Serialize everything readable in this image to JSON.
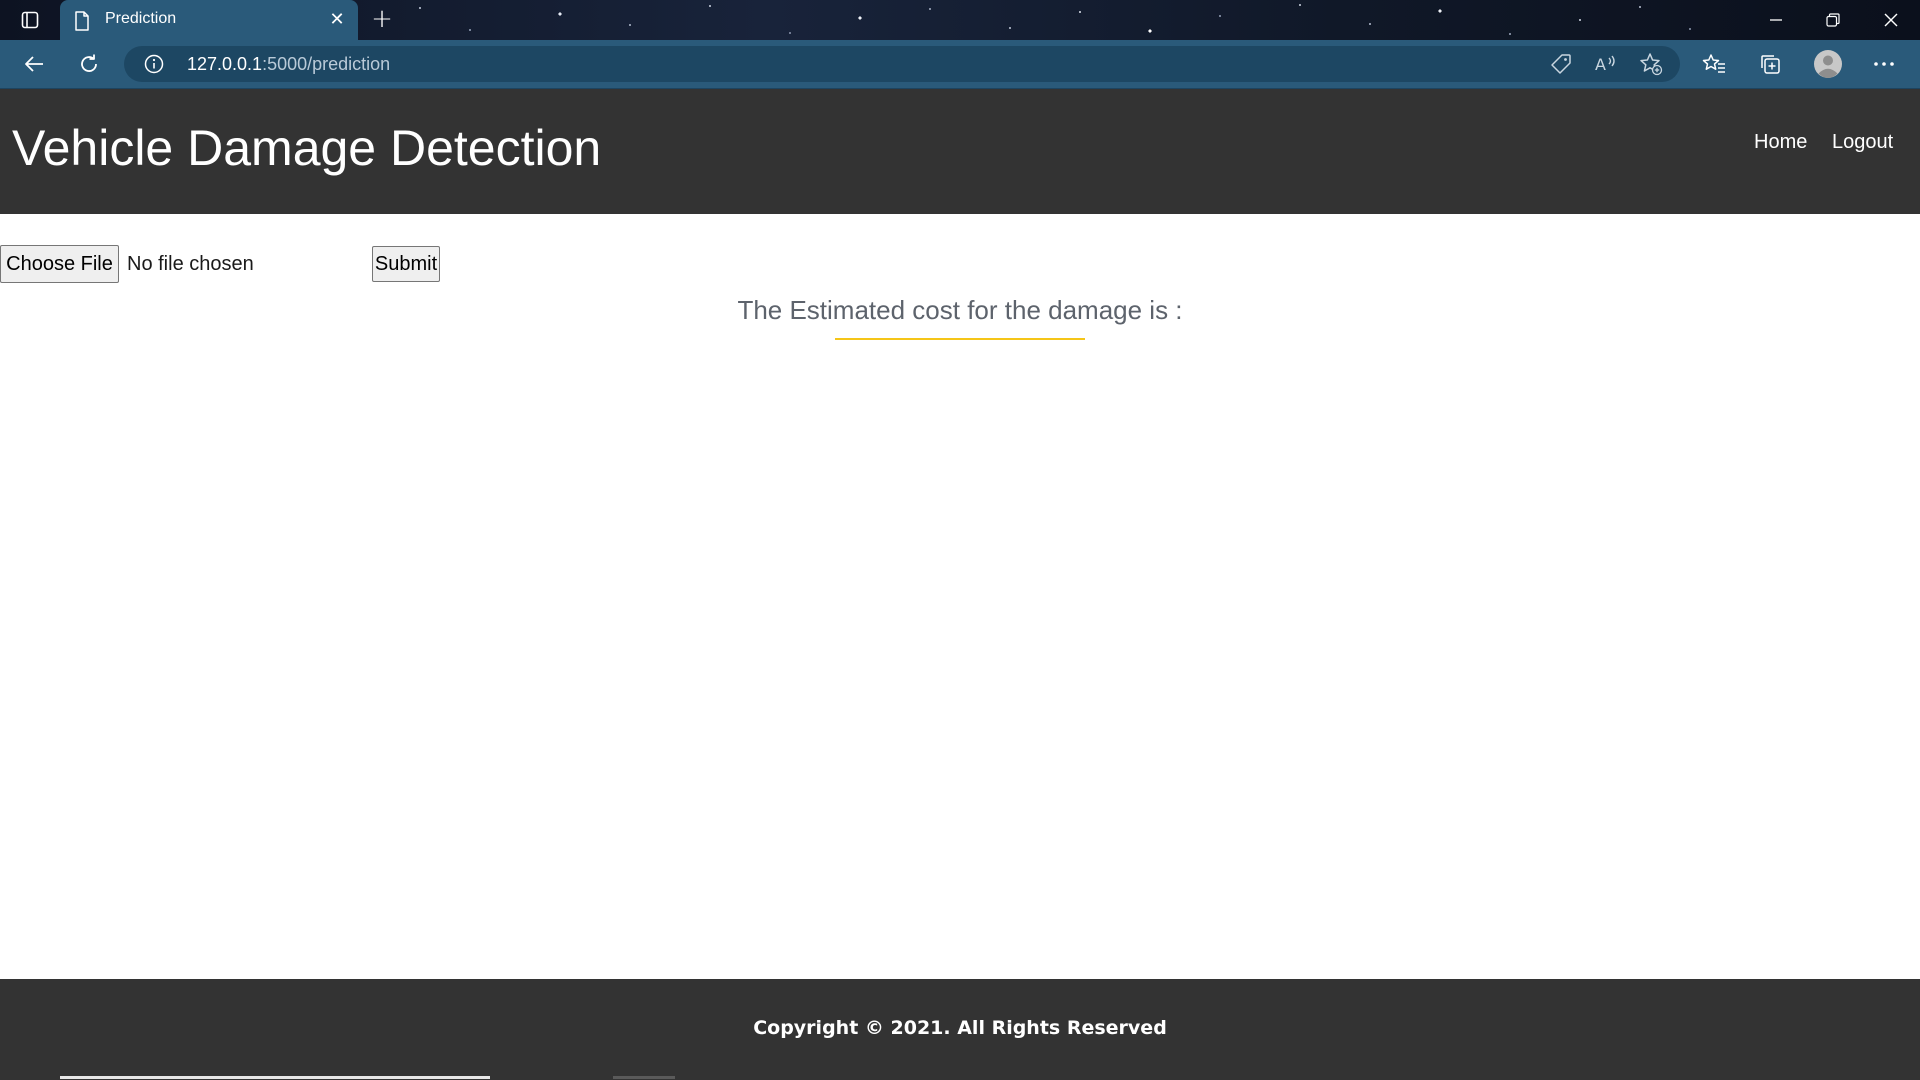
{
  "browser": {
    "tab": {
      "title": "Prediction"
    },
    "address": {
      "host": "127.0.0.1",
      "path": ":5000/prediction"
    },
    "icons": {
      "sidebar": "sidebar-toggle-icon",
      "page": "page-icon",
      "close": "close-icon",
      "new_tab": "plus-icon",
      "minimize": "minimize-icon",
      "restore": "restore-icon",
      "window_close": "close-icon",
      "back": "back-arrow-icon",
      "refresh": "refresh-icon",
      "info": "info-icon",
      "shopping": "tag-icon",
      "read_aloud": "read-aloud-icon",
      "add_favorite": "star-add-icon",
      "favorites": "favorites-icon",
      "collections": "collections-icon",
      "profile": "profile-icon",
      "more": "more-icon"
    },
    "colors": {
      "tab_bg": "#2a5a7a",
      "toolbar_bg": "#2a5a7a",
      "addressbar_bg": "#1d4763"
    }
  },
  "page": {
    "header": {
      "title": "Vehicle Damage Detection",
      "nav": {
        "home": "Home",
        "logout": "Logout"
      }
    },
    "upload": {
      "choose_label": "Choose File",
      "status": "No file chosen",
      "submit_label": "Submit"
    },
    "result": {
      "heading": "The Estimated cost for the damage is :"
    },
    "footer": {
      "text": "Copyright © 2021. All Rights Reserved"
    },
    "colors": {
      "header_bg": "#333333",
      "footer_bg": "#333333",
      "accent": "#f5c518",
      "heading_text": "#5d636c"
    }
  }
}
